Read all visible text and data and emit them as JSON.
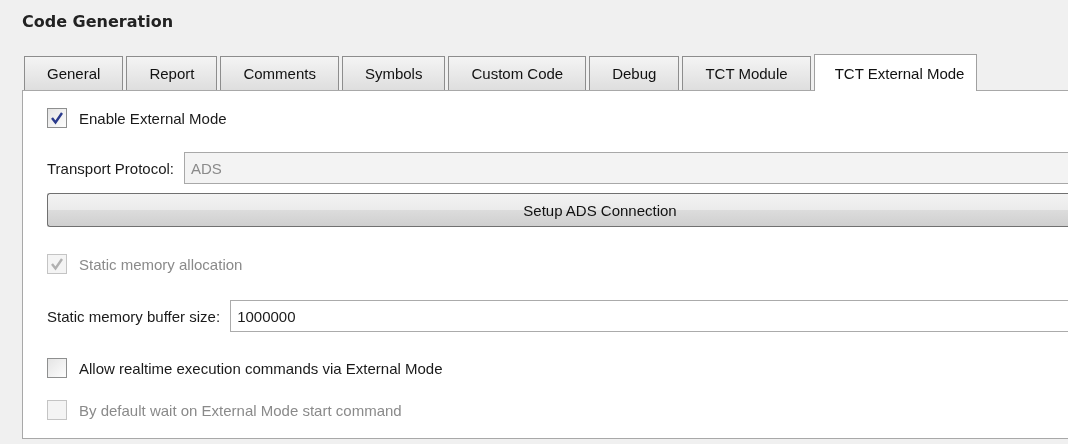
{
  "title": "Code Generation",
  "tabs": [
    {
      "label": "General",
      "selected": false
    },
    {
      "label": "Report",
      "selected": false
    },
    {
      "label": "Comments",
      "selected": false
    },
    {
      "label": "Symbols",
      "selected": false
    },
    {
      "label": "Custom Code",
      "selected": false
    },
    {
      "label": "Debug",
      "selected": false
    },
    {
      "label": "TCT Module",
      "selected": false
    },
    {
      "label": "TCT External Mode",
      "selected": true
    }
  ],
  "settings": [
    {
      "kind": "checkbox",
      "label": "Enable External Mode",
      "checked": true,
      "disabled": false
    },
    {
      "kind": "field",
      "label": "Transport Protocol:",
      "value": "ADS",
      "disabled": true
    },
    {
      "kind": "button",
      "label": "Setup ADS Connection"
    },
    {
      "kind": "checkbox",
      "label": "Static memory allocation",
      "checked": true,
      "disabled": true
    },
    {
      "kind": "field",
      "label": "Static memory buffer size:",
      "value": "1000000",
      "disabled": false
    },
    {
      "kind": "checkbox",
      "label": "Allow realtime execution commands via External Mode",
      "checked": false,
      "disabled": false
    },
    {
      "kind": "checkbox",
      "label": "By default wait on External Mode start command",
      "checked": false,
      "disabled": true
    }
  ]
}
